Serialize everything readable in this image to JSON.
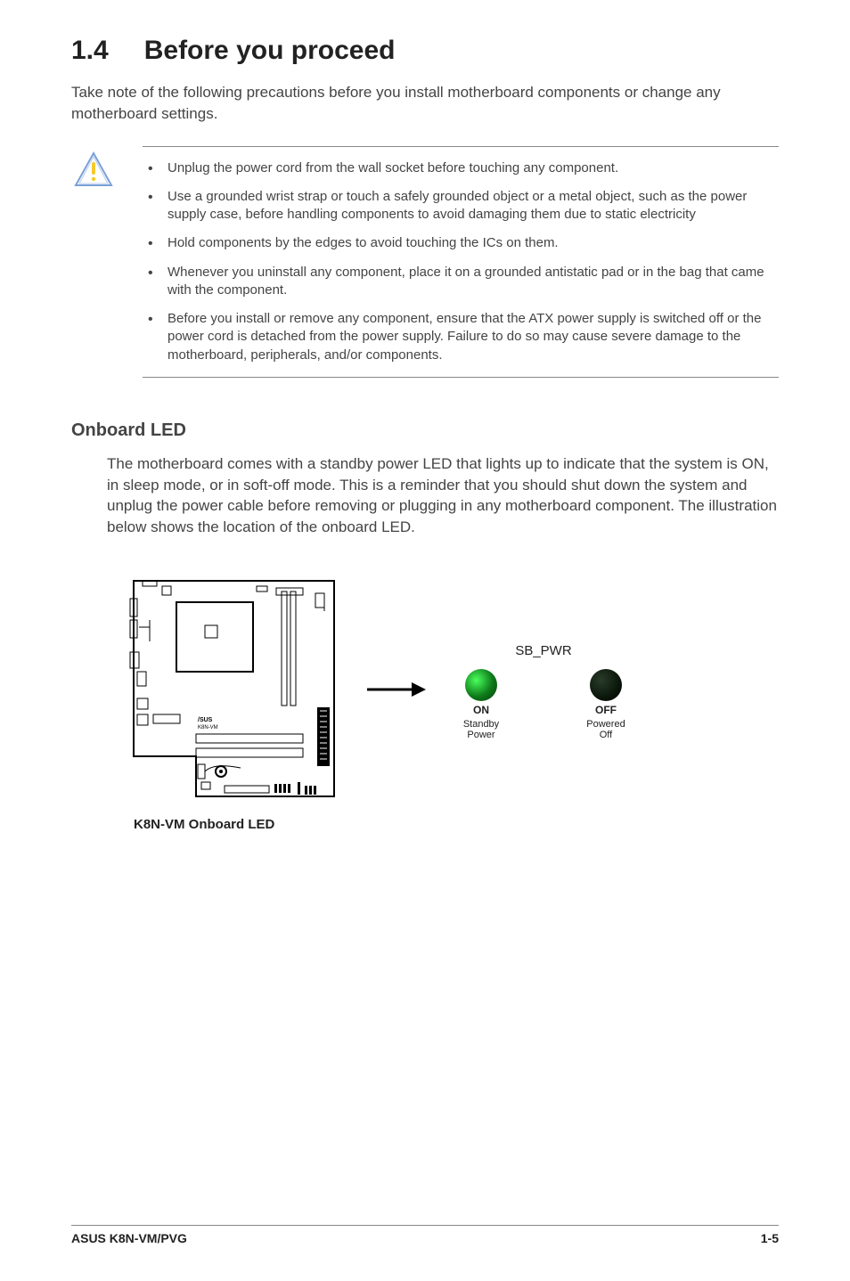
{
  "heading": {
    "num": "1.4",
    "text": "Before you proceed"
  },
  "intro": "Take note of the following precautions before you install motherboard components or change any motherboard settings.",
  "cautions": [
    "Unplug the power cord from the wall socket before touching any component.",
    "Use a grounded wrist strap or touch a safely grounded object or a metal object, such as the power supply case, before handling components to avoid damaging them due to static electricity",
    "Hold components by the edges to avoid touching the ICs on them.",
    "Whenever you uninstall any component, place it on a grounded antistatic pad or in the bag that came with the component.",
    "Before you install or remove any component, ensure that the ATX power supply is switched off or the power cord is detached from the power supply. Failure to do so may cause severe damage to the motherboard, peripherals, and/or components."
  ],
  "onboard": {
    "subheading": "Onboard LED",
    "para": "The motherboard comes with a standby power LED that lights up to indicate that the system is ON, in sleep mode, or in soft-off mode. This is a reminder that you should shut down the system and unplug the power cable before removing or plugging in any motherboard component. The illustration below shows the location of the onboard LED."
  },
  "diagram": {
    "mobo_brand": "K8N-VM",
    "caption": "K8N-VM Onboard LED",
    "sbpwr": "SB_PWR",
    "led_on": {
      "state": "ON",
      "desc1": "Standby",
      "desc2": "Power"
    },
    "led_off": {
      "state": "OFF",
      "desc1": "Powered",
      "desc2": "Off"
    }
  },
  "footer": {
    "left": "ASUS K8N-VM/PVG",
    "right": "1-5"
  }
}
